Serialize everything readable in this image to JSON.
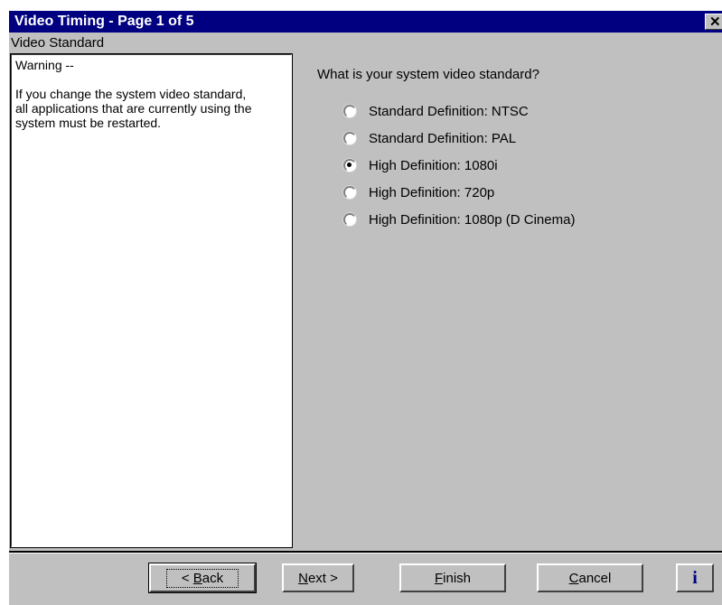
{
  "window": {
    "title": "Video Timing - Page 1 of 5",
    "close_label": "✕"
  },
  "section_label": "Video Standard",
  "warning": {
    "title": "Warning --",
    "body": "If you change the system video standard, all applications that are currently using the system must be restarted."
  },
  "question": "What is your system video standard?",
  "options": [
    {
      "label": "Standard Definition: NTSC",
      "selected": false
    },
    {
      "label": "Standard Definition: PAL",
      "selected": false
    },
    {
      "label": "High Definition: 1080i",
      "selected": true
    },
    {
      "label": "High Definition: 720p",
      "selected": false
    },
    {
      "label": "High Definition: 1080p (D Cinema)",
      "selected": false
    }
  ],
  "buttons": {
    "back": {
      "prefix": "< ",
      "accel": "B",
      "rest": "ack"
    },
    "next": {
      "accel": "N",
      "rest": "ext >"
    },
    "finish": {
      "accel": "F",
      "rest": "inish"
    },
    "cancel": {
      "accel": "C",
      "rest": "ancel"
    },
    "info": "i"
  },
  "colors": {
    "titlebar": "#000080",
    "dialog_bg": "#c0c0c0",
    "info_icon": "#000080"
  },
  "icons": [
    "close-icon",
    "info-icon"
  ]
}
